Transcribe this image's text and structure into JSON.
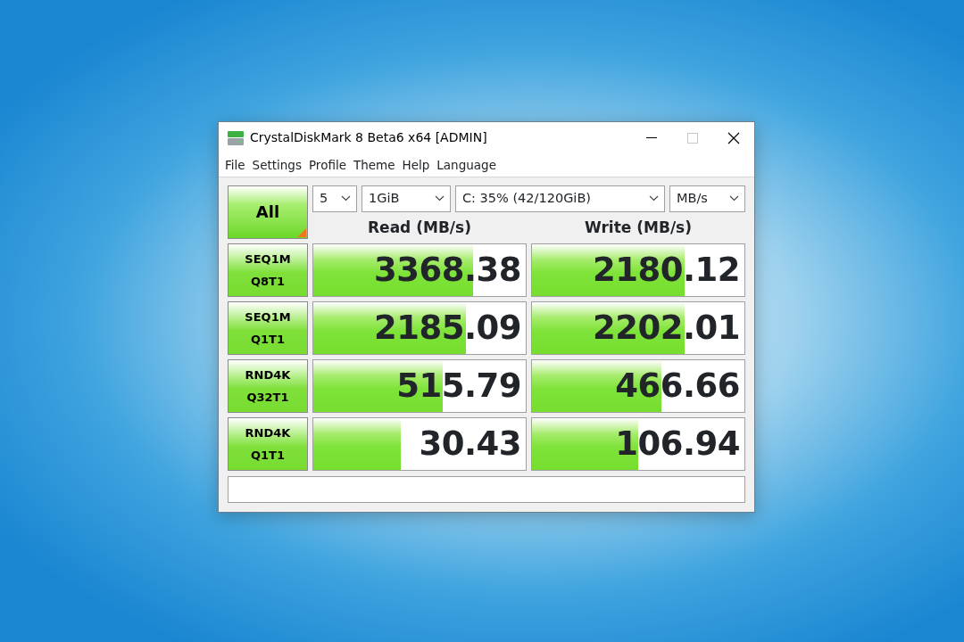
{
  "window": {
    "title": "CrystalDiskMark 8 Beta6 x64 [ADMIN]"
  },
  "menu": [
    "File",
    "Settings",
    "Profile",
    "Theme",
    "Help",
    "Language"
  ],
  "all_button": {
    "label": "All"
  },
  "selects": [
    {
      "value": "5"
    },
    {
      "value": "1GiB"
    },
    {
      "value": "C: 35% (42/120GiB)"
    },
    {
      "value": "MB/s"
    }
  ],
  "columns": [
    "Read (MB/s)",
    "Write (MB/s)"
  ],
  "rows": [
    {
      "test": [
        "SEQ1M",
        "Q8T1"
      ],
      "read": {
        "value": "3368.38",
        "level": 0.75
      },
      "write": {
        "value": "2180.12",
        "level": 0.72
      }
    },
    {
      "test": [
        "SEQ1M",
        "Q1T1"
      ],
      "read": {
        "value": "2185.09",
        "level": 0.72
      },
      "write": {
        "value": "2202.01",
        "level": 0.72
      }
    },
    {
      "test": [
        "RND4K",
        "Q32T1"
      ],
      "read": {
        "value": "515.79",
        "level": 0.61
      },
      "write": {
        "value": "466.66",
        "level": 0.61
      }
    },
    {
      "test": [
        "RND4K",
        "Q1T1"
      ],
      "read": {
        "value": "30.43",
        "level": 0.41
      },
      "write": {
        "value": "106.94",
        "level": 0.5
      }
    }
  ]
}
